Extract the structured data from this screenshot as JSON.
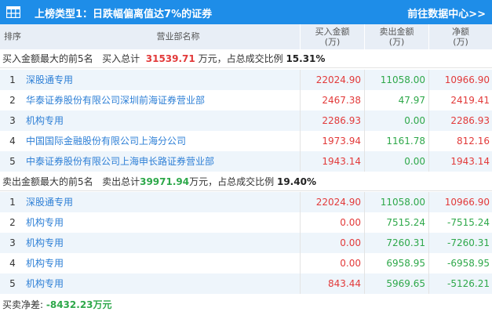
{
  "header": {
    "title": "上榜类型1：日跌幅偏离值达7%的证券",
    "link": "前往数据中心>>"
  },
  "columns": {
    "rank": "排序",
    "dept": "营业部名称",
    "buy": "买入金额",
    "sell": "卖出金额",
    "net": "净额",
    "unit": "(万)"
  },
  "buy_section": {
    "label": "买入金额最大的前5名",
    "total_label": "买入总计",
    "total_value": "31539.71",
    "unit": "万元，",
    "ratio_label": "占总成交比例",
    "ratio_value": "15.31%",
    "rows": [
      {
        "rank": "1",
        "name": "深股通专用",
        "buy": "22024.90",
        "sell": "11058.00",
        "net": "10966.90"
      },
      {
        "rank": "2",
        "name": "华泰证券股份有限公司深圳前海证券营业部",
        "buy": "2467.38",
        "sell": "47.97",
        "net": "2419.41"
      },
      {
        "rank": "3",
        "name": "机构专用",
        "buy": "2286.93",
        "sell": "0.00",
        "net": "2286.93"
      },
      {
        "rank": "4",
        "name": "中国国际金融股份有限公司上海分公司",
        "buy": "1973.94",
        "sell": "1161.78",
        "net": "812.16"
      },
      {
        "rank": "5",
        "name": "中泰证券股份有限公司上海申长路证券营业部",
        "buy": "1943.14",
        "sell": "0.00",
        "net": "1943.14"
      }
    ]
  },
  "sell_section": {
    "label": "卖出金额最大的前5名",
    "total_label": "卖出总计",
    "total_value": "39971.94",
    "unit": "万元，",
    "ratio_label": "占总成交比例",
    "ratio_value": "19.40%",
    "rows": [
      {
        "rank": "1",
        "name": "深股通专用",
        "buy": "22024.90",
        "sell": "11058.00",
        "net": "10966.90"
      },
      {
        "rank": "2",
        "name": "机构专用",
        "buy": "0.00",
        "sell": "7515.24",
        "net": "-7515.24"
      },
      {
        "rank": "3",
        "name": "机构专用",
        "buy": "0.00",
        "sell": "7260.31",
        "net": "-7260.31"
      },
      {
        "rank": "4",
        "name": "机构专用",
        "buy": "0.00",
        "sell": "6958.95",
        "net": "-6958.95"
      },
      {
        "rank": "5",
        "name": "机构专用",
        "buy": "843.44",
        "sell": "5969.65",
        "net": "-5126.21"
      }
    ]
  },
  "footer": {
    "label": "买卖净差:",
    "value": "-8432.23万元"
  }
}
